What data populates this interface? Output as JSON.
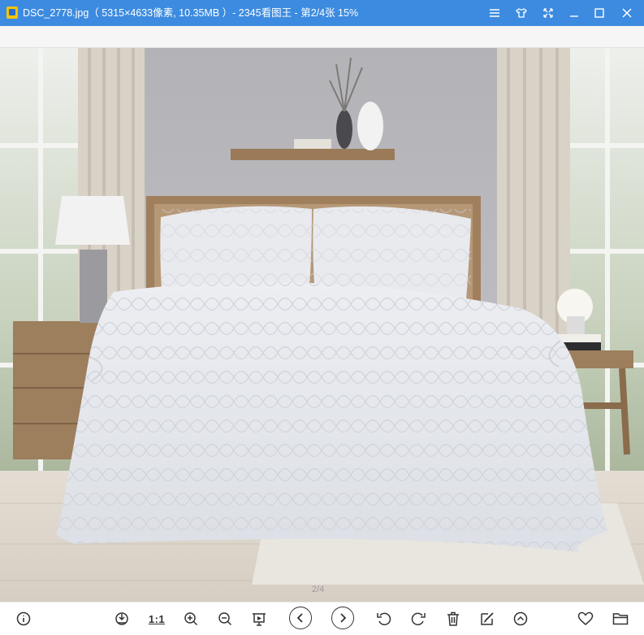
{
  "window": {
    "title": "DSC_2778.jpg（ 5315×4633像素, 10.35MB ）- 2345看图王 - 第2/4张 15%"
  },
  "window_controls": [
    "menu-icon",
    "skin-icon",
    "fullscreen-icon",
    "minimize-icon",
    "maximize-icon",
    "close-icon"
  ],
  "viewer": {
    "page_indicator": "2/4"
  },
  "bottom_toolbar": {
    "actual_size_label": "1:1",
    "buttons": [
      "info-icon",
      "rotate-save-icon",
      "actual-size",
      "zoom-in-icon",
      "zoom-out-icon",
      "slideshow-icon",
      "previous-icon",
      "next-icon",
      "rotate-left-icon",
      "rotate-right-icon",
      "delete-icon",
      "edit-icon",
      "collapse-icon",
      "favorite-icon",
      "folder-icon"
    ]
  },
  "colors": {
    "titlebar": "#3c8be0",
    "wall": "#b8b8bc",
    "bedding": "#e6e8ec",
    "wood": "#a07f5c"
  }
}
